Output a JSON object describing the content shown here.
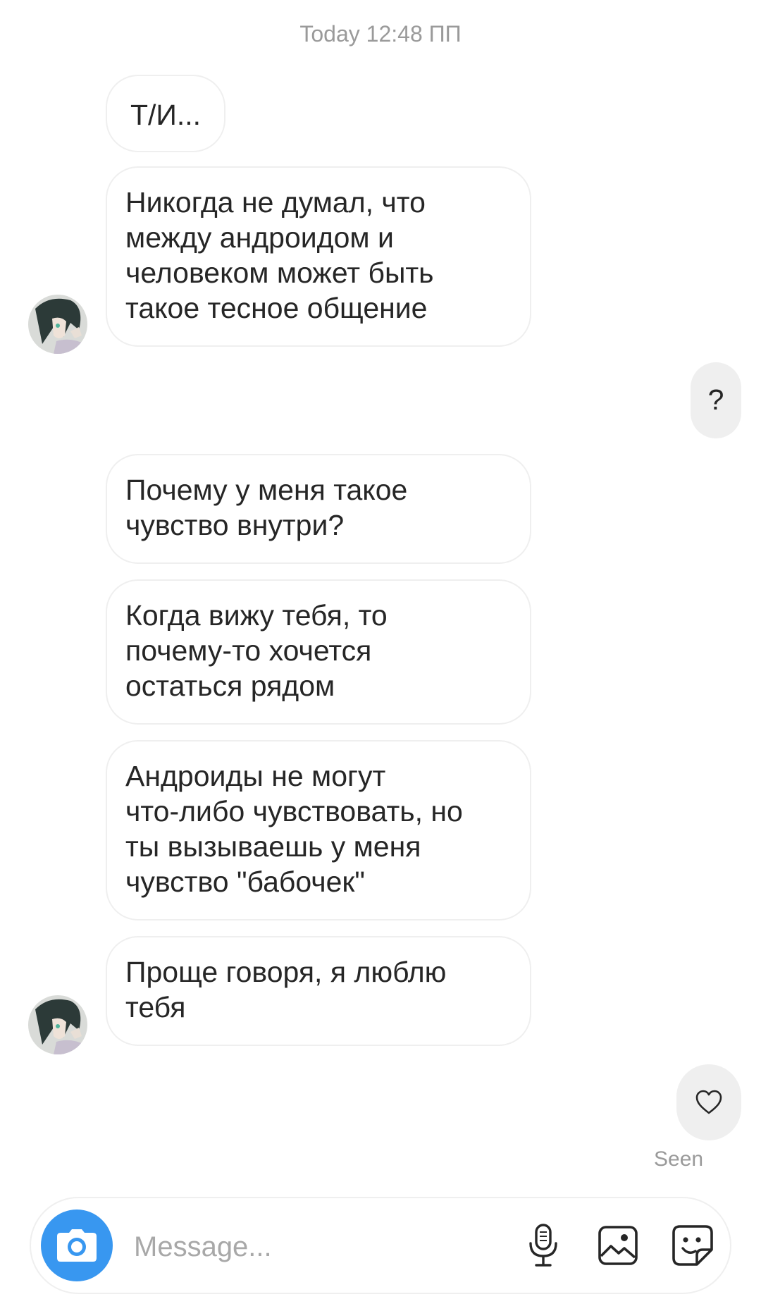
{
  "thread": {
    "timestamp": "Today 12:48 ПП",
    "messages": [
      {
        "direction": "in",
        "text": "Т/И..."
      },
      {
        "direction": "in",
        "text": "Никогда не думал, что\nмежду андроидом и\nчеловеком может быть\nтакое тесное общение"
      },
      {
        "direction": "out",
        "text": "?"
      },
      {
        "direction": "in",
        "text": "Почему у меня такое\nчувство внутри?"
      },
      {
        "direction": "in",
        "text": "Когда вижу тебя, то\nпочему-то хочется\nостаться рядом"
      },
      {
        "direction": "in",
        "text": "Андроиды не могут\nчто-либо чувствовать, но\nты вызываешь у меня\nчувство \"бабочек\""
      },
      {
        "direction": "in",
        "text": "Проще говоря, я люблю\nтебя"
      }
    ],
    "reaction_icon": "heart-icon",
    "seen_label": "Seen"
  },
  "composer": {
    "placeholder": "Message...",
    "icons": [
      "camera-icon",
      "microphone-icon",
      "gallery-icon",
      "sticker-icon"
    ],
    "accent_color": "#3897f0"
  }
}
